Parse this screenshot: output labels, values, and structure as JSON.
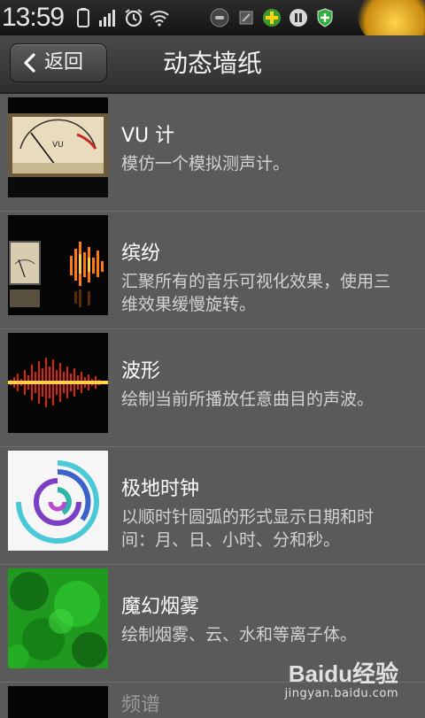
{
  "status_bar": {
    "time": "13:59",
    "icons": [
      "battery-icon",
      "signal-icon",
      "alarm-icon",
      "wifi-icon",
      "headset-icon",
      "notification-icon",
      "app-icon",
      "pause-icon",
      "shield-icon"
    ]
  },
  "header": {
    "back_label": "返回",
    "title": "动态墙纸"
  },
  "wallpapers": [
    {
      "title": "VU 计",
      "description": "模仿一个模拟测声计。",
      "icon": "vu-meter-thumbnail"
    },
    {
      "title": "缤纷",
      "description": "汇聚所有的音乐可视化效果，使用三维效果缓慢旋转。",
      "icon": "visualizer-thumbnail"
    },
    {
      "title": "波形",
      "description": "绘制当前所播放任意曲目的声波。",
      "icon": "waveform-thumbnail"
    },
    {
      "title": "极地时钟",
      "description": "以顺时针圆弧的形式显示日期和时间：月、日、小时、分和秒。",
      "icon": "polar-clock-thumbnail"
    },
    {
      "title": "魔幻烟雾",
      "description": "绘制烟雾、云、水和等离子体。",
      "icon": "magic-smoke-thumbnail"
    },
    {
      "title": "频谱",
      "icon": "spectrum-thumbnail"
    }
  ],
  "watermark": {
    "brand": "Baidu经验",
    "url": "jingyan.baidu.com"
  },
  "colors": {
    "list_background": "#5a5a5a",
    "titlebar": "#3a3a3a",
    "divider": "#6e6e6e"
  }
}
